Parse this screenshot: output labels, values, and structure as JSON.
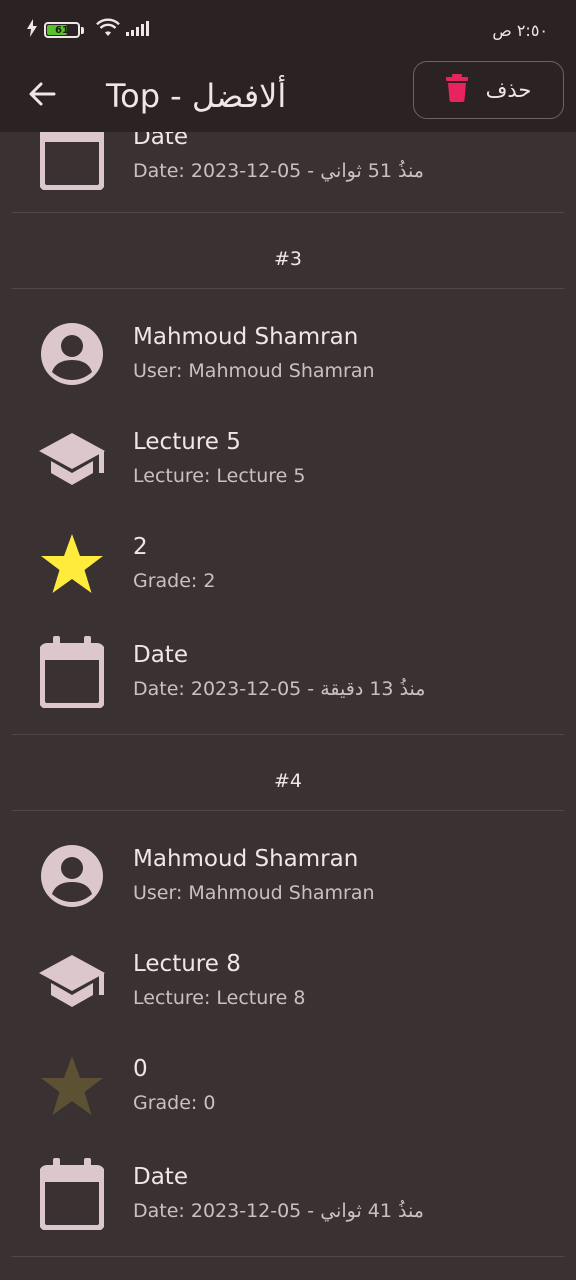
{
  "status_bar": {
    "battery_level": "61",
    "battery_fraction": 0.61,
    "time": "٢:٥٠ ص"
  },
  "app_bar": {
    "title": "Top - ألافضل",
    "delete_label": "حذف"
  },
  "colors": {
    "background": "#3a3133",
    "bar_background": "#2b2224",
    "icon_tint": "#dcc8cc",
    "star_active": "#ffeb3b",
    "star_inactive": "#5c5233",
    "delete_icon": "#e8245e",
    "battery_fill": "#58c12c"
  },
  "top_partial": {
    "date_title": "Date",
    "date_sub": "Date: 2023-12-05  -  منذُ 51 ثواني"
  },
  "entries": [
    {
      "rank": "#3",
      "user_name": "Mahmoud Shamran",
      "user_sub": "User: Mahmoud Shamran",
      "lecture_name": "Lecture 5",
      "lecture_sub": "Lecture: Lecture 5",
      "grade_value": "2",
      "grade_sub": "Grade: 2",
      "date_title": "Date",
      "date_sub": "Date: 2023-12-05  -  منذُ 13 دقيقة"
    },
    {
      "rank": "#4",
      "user_name": "Mahmoud Shamran",
      "user_sub": "User: Mahmoud Shamran",
      "lecture_name": "Lecture 8",
      "lecture_sub": "Lecture: Lecture 8",
      "grade_value": "0",
      "grade_sub": "Grade: 0",
      "date_title": "Date",
      "date_sub": "Date: 2023-12-05  -  منذُ 41 ثواني"
    }
  ]
}
